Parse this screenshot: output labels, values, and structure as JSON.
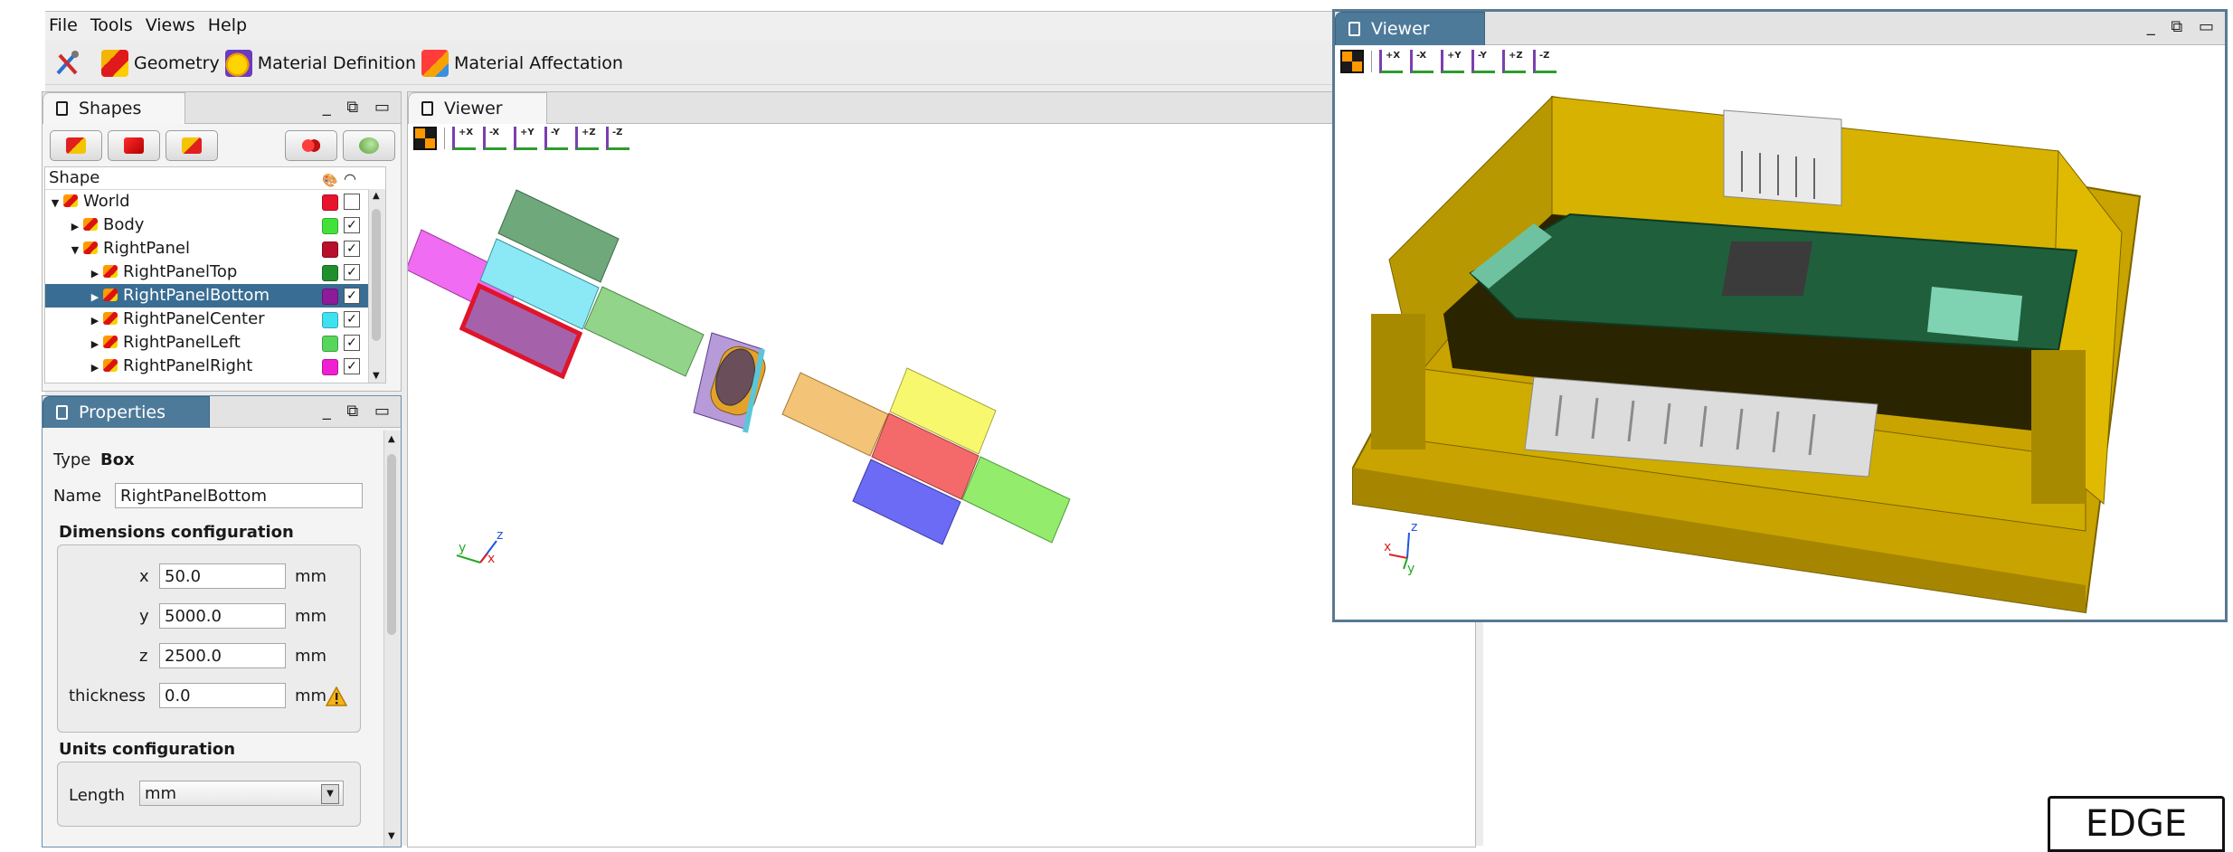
{
  "menu": [
    "File",
    "Tools",
    "Views",
    "Help"
  ],
  "toolbar": {
    "items": [
      {
        "label": ""
      },
      {
        "label": "Geometry"
      },
      {
        "label": "Material Definition"
      },
      {
        "label": "Material Affectation"
      }
    ]
  },
  "shapes_panel": {
    "title": "Shapes",
    "tree_header": "Shape",
    "rows": [
      {
        "label": "World",
        "color": "#e8142e",
        "checked": "",
        "expanded": "▼",
        "depth": 0
      },
      {
        "label": "Body",
        "color": "#43e23b",
        "checked": "✓",
        "expanded": "▶",
        "depth": 1
      },
      {
        "label": "RightPanel",
        "color": "#b8102a",
        "checked": "✓",
        "expanded": "▼",
        "depth": 1
      },
      {
        "label": "RightPanelTop",
        "color": "#1f8f2b",
        "checked": "✓",
        "expanded": "▶",
        "depth": 2
      },
      {
        "label": "RightPanelBottom",
        "color": "#8d1b9a",
        "checked": "✓",
        "expanded": "▶",
        "depth": 2
      },
      {
        "label": "RightPanelCenter",
        "color": "#3fe0ef",
        "checked": "✓",
        "expanded": "▶",
        "depth": 2
      },
      {
        "label": "RightPanelLeft",
        "color": "#56d65b",
        "checked": "✓",
        "expanded": "▶",
        "depth": 2
      },
      {
        "label": "RightPanelRight",
        "color": "#f01fd2",
        "checked": "✓",
        "expanded": "▶",
        "depth": 2
      }
    ]
  },
  "properties_panel": {
    "title": "Properties",
    "type_label": "Type",
    "type_value": "Box",
    "name_label": "Name",
    "name_value": "RightPanelBottom",
    "dimensions_title": "Dimensions configuration",
    "dims": [
      {
        "label": "x",
        "value": "50.0",
        "unit": "mm"
      },
      {
        "label": "y",
        "value": "5000.0",
        "unit": "mm"
      },
      {
        "label": "z",
        "value": "2500.0",
        "unit": "mm"
      },
      {
        "label": "thickness",
        "value": "0.0",
        "unit": "mm"
      }
    ],
    "units_title": "Units configuration",
    "length_label": "Length",
    "length_value": "mm"
  },
  "center_viewer": {
    "title": "Viewer",
    "view_buttons": [
      "+X",
      "-X",
      "+Y",
      "-Y",
      "+Z",
      "-Z"
    ],
    "axis_labels": {
      "x": "x",
      "y": "y",
      "z": "z"
    }
  },
  "float_viewer": {
    "title": "Viewer",
    "view_buttons": [
      "+X",
      "-X",
      "+Y",
      "-Y",
      "+Z",
      "-Z"
    ],
    "axis_labels": {
      "x": "x",
      "y": "y",
      "z": "z"
    }
  },
  "edge_label": "EDGE"
}
